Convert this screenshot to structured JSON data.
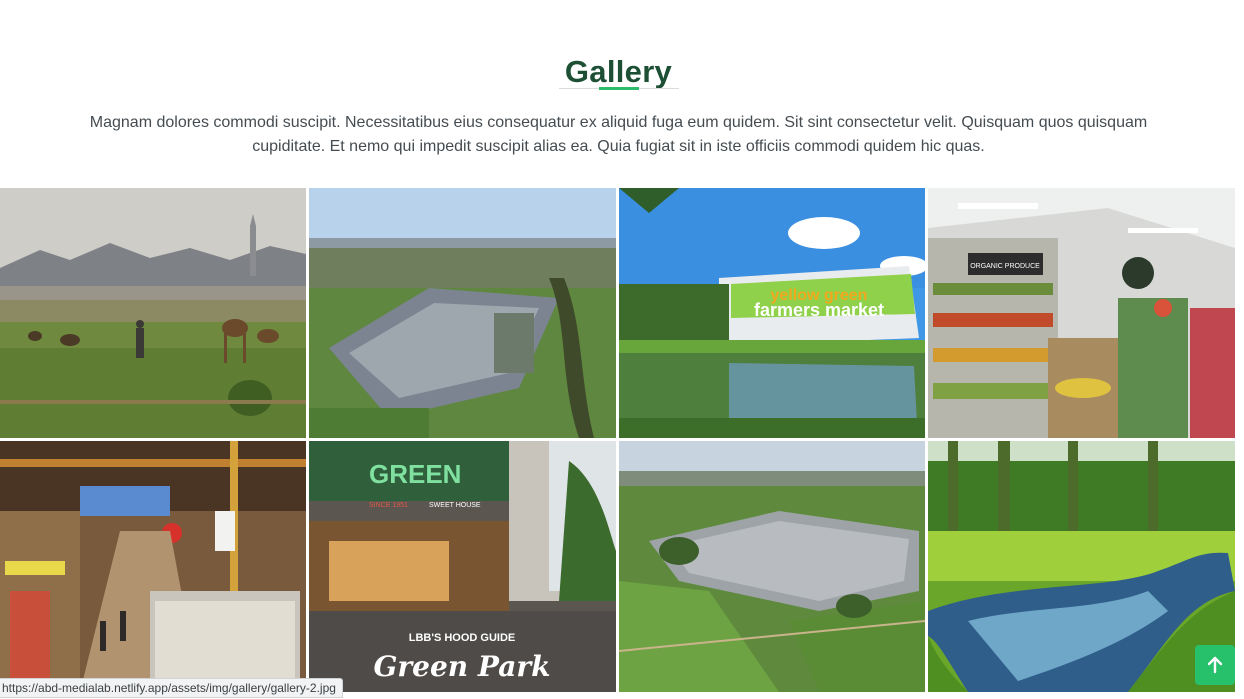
{
  "section": {
    "title": "Gallery",
    "description": "Magnam dolores commodi suscipit. Necessitatibus eius consequatur ex aliquid fuga eum quidem. Sit sint consectetur velit. Quisquam quos quisquam cupiditate. Et nemo qui impedit suscipit alias ea. Quia fugiat sit in iste officiis commodi quidem hic quas."
  },
  "gallery": {
    "images": [
      {
        "subject": "desert-landscape-with-camels"
      },
      {
        "subject": "aerial-market-parking-lot"
      },
      {
        "subject": "farmers-market-building-pond"
      },
      {
        "subject": "organic-produce-aisle"
      },
      {
        "subject": "indoor-market-hall"
      },
      {
        "subject": "greenpark-street-storefronts"
      },
      {
        "subject": "aerial-fairground-fields"
      },
      {
        "subject": "forest-stream-meadow"
      }
    ],
    "signs": {
      "market_sign_line1": "yellow green",
      "market_sign_line2": "farmers market",
      "store_sign": "GREEN",
      "store_since": "SINCE 1951",
      "store_sub": "SWEET HOUSE",
      "guide_title": "LBB'S HOOD GUIDE",
      "guide_script": "Green Park",
      "produce_sign": "ORGANIC PRODUCE"
    }
  },
  "status_bar": {
    "url": "https://abd-medialab.netlify.app/assets/img/gallery/gallery-2.jpg"
  },
  "back_to_top": {
    "icon": "arrow-up-icon",
    "color": "#27c06b"
  },
  "colors": {
    "title": "#1d4f34",
    "accent": "#2cbc6c",
    "text": "#454c51"
  }
}
